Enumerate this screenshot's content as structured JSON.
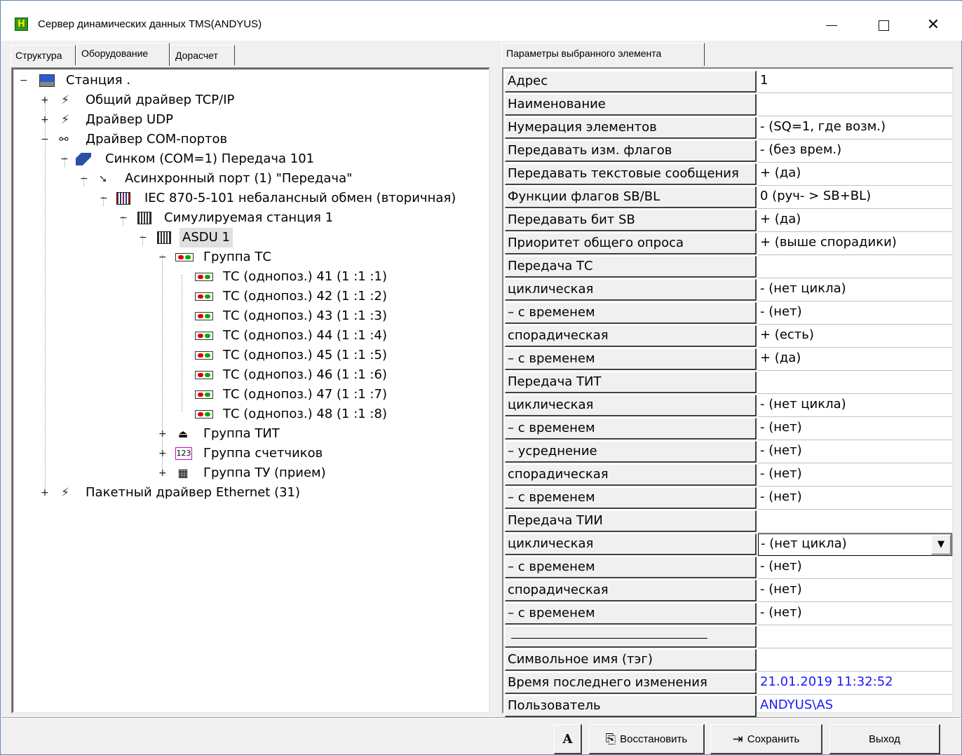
{
  "window": {
    "title": "Сервер динамических данных TMS(ANDYUS)",
    "icon_glyph": "H"
  },
  "left_tabs": [
    {
      "label": "Структура"
    },
    {
      "label": "Оборудование"
    },
    {
      "label": "Дорасчет"
    }
  ],
  "right_tab": {
    "label": "Параметры выбранного элемента"
  },
  "tree": [
    {
      "label": "Станция .",
      "expander": "−",
      "icon": "station-icon"
    },
    {
      "label": "Общий драйвер TCP/IP",
      "expander": "+",
      "icon": "network-driver-icon"
    },
    {
      "label": "Драйвер UDP",
      "expander": "+",
      "icon": "network-driver-icon"
    },
    {
      "label": "Драйвер COM-портов",
      "expander": "−",
      "icon": "com-driver-icon"
    },
    {
      "label": "Синком  (COM=1) Передача 101",
      "expander": "−",
      "icon": "sinkom-icon"
    },
    {
      "label": "Асинхронный порт  (1) \"Передача\"",
      "expander": "−",
      "icon": "port-icon"
    },
    {
      "label": "IEC 870-5-101 небалансный обмен (вторичная)",
      "expander": "−",
      "icon": "protocol-icon"
    },
    {
      "label": "Симулируемая станция  1",
      "expander": "−",
      "icon": "rack-icon"
    },
    {
      "label": "ASDU  1",
      "expander": "−",
      "icon": "rack-icon"
    },
    {
      "label": "Группа ТС",
      "expander": "−",
      "icon": "ts-group-icon"
    },
    {
      "label": "ТС (однопоз.)  41 (1 :1 :1)",
      "icon": "ts-icon"
    },
    {
      "label": "ТС (однопоз.)  42 (1 :1 :2)",
      "icon": "ts-icon"
    },
    {
      "label": "ТС (однопоз.)  43 (1 :1 :3)",
      "icon": "ts-icon"
    },
    {
      "label": "ТС (однопоз.)  44 (1 :1 :4)",
      "icon": "ts-icon"
    },
    {
      "label": "ТС (однопоз.)  45 (1 :1 :5)",
      "icon": "ts-icon"
    },
    {
      "label": "ТС (однопоз.)  46 (1 :1 :6)",
      "icon": "ts-icon"
    },
    {
      "label": "ТС (однопоз.)  47 (1 :1 :7)",
      "icon": "ts-icon"
    },
    {
      "label": "ТС (однопоз.)  48 (1 :1 :8)",
      "icon": "ts-icon"
    },
    {
      "label": "Группа ТИТ",
      "expander": "+",
      "icon": "tit-group-icon"
    },
    {
      "label": "Группа счетчиков",
      "expander": "+",
      "icon": "counter-group-icon",
      "icon_text": "123"
    },
    {
      "label": "Группа ТУ (прием)",
      "expander": "+",
      "icon": "tu-group-icon"
    },
    {
      "label": "Пакетный драйвер Ethernet  (31)",
      "expander": "+",
      "icon": "network-driver-icon"
    }
  ],
  "properties": [
    {
      "name": "Адрес",
      "value": "1"
    },
    {
      "name": "Наименование",
      "value": ""
    },
    {
      "name": "Нумерация элементов",
      "value": "- (SQ=1, где возм.)"
    },
    {
      "name": "Передавать изм. флагов",
      "value": "- (без врем.)"
    },
    {
      "name": "Передавать текстовые сообщения",
      "value": "+ (да)"
    },
    {
      "name": "Функции флагов SB/BL",
      "value": "0 (руч- > SB+BL)"
    },
    {
      "name": "Передавать бит SB",
      "value": "+ (да)"
    },
    {
      "name": "Приоритет общего опроса",
      "value": "+ (выше спорадики)"
    },
    {
      "name": "Передача ТС",
      "value": ""
    },
    {
      "name": "циклическая",
      "value": "- (нет цикла)"
    },
    {
      "name": "– с временем",
      "value": "- (нет)"
    },
    {
      "name": "спорадическая",
      "value": "+ (есть)"
    },
    {
      "name": "– с временем",
      "value": "+ (да)"
    },
    {
      "name": "Передача ТИТ",
      "value": ""
    },
    {
      "name": "циклическая",
      "value": "- (нет цикла)"
    },
    {
      "name": "– с временем",
      "value": "- (нет)"
    },
    {
      "name": "– усреднение",
      "value": "- (нет)"
    },
    {
      "name": "спорадическая",
      "value": "- (нет)"
    },
    {
      "name": "– с временем",
      "value": "- (нет)"
    },
    {
      "name": "Передача ТИИ",
      "value": ""
    },
    {
      "name": "циклическая",
      "value": "- (нет цикла)"
    },
    {
      "name": "– с временем",
      "value": "- (нет)"
    },
    {
      "name": "спорадическая",
      "value": "- (нет)"
    },
    {
      "name": "– с временем",
      "value": "- (нет)"
    },
    {
      "name": "",
      "value": ""
    },
    {
      "name": "Символьное имя (тэг)",
      "value": ""
    },
    {
      "name": "Время последнего изменения",
      "value": "21.01.2019 11:32:52"
    },
    {
      "name": "Пользователь",
      "value": "ANDYUS\\AS"
    }
  ],
  "buttons": {
    "font": "A",
    "restore": "Восстановить",
    "save": "Сохранить",
    "exit": "Выход"
  },
  "colors": {
    "link": "#1a1aff",
    "app_icon": "#2f9a1a"
  }
}
